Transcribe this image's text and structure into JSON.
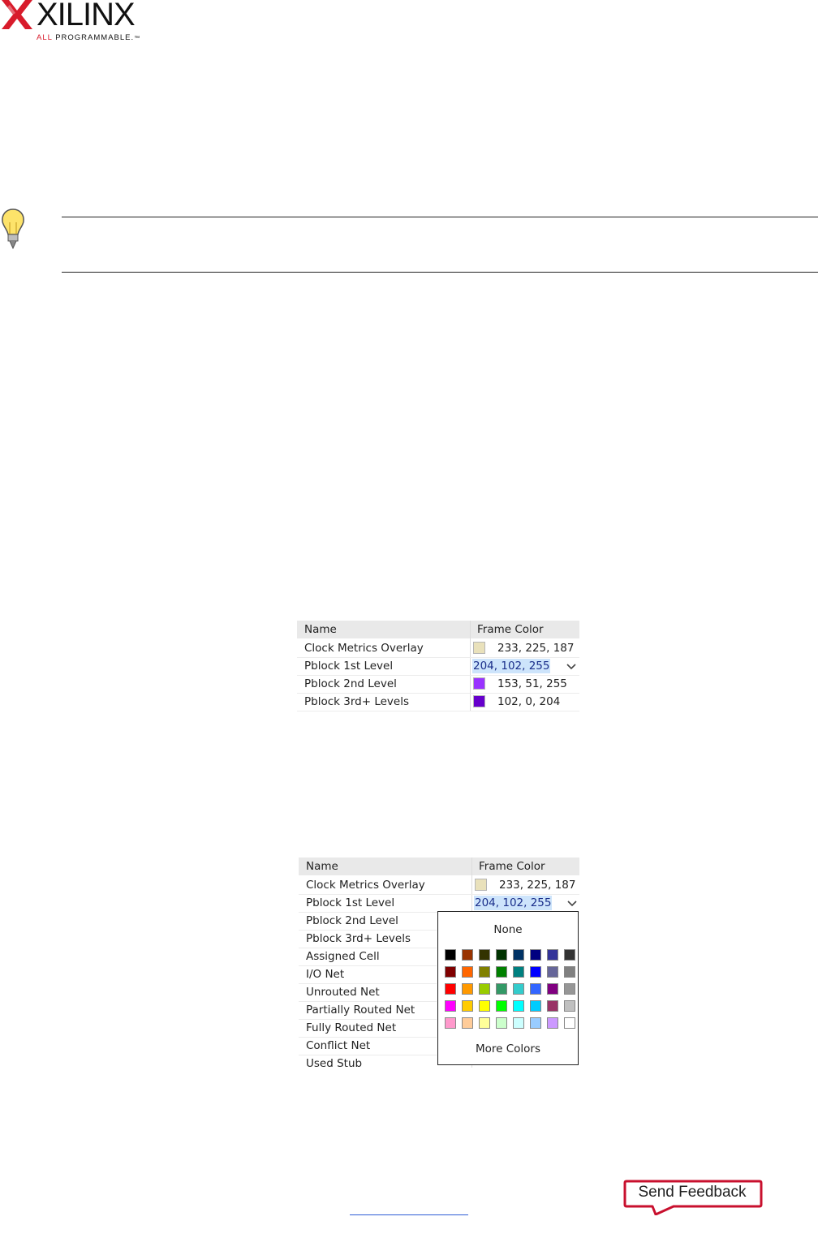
{
  "logo": {
    "wordmark": "XILINX",
    "tagline_prefix": "ALL",
    "tagline_rest": " PROGRAMMABLE.",
    "trademark": "™"
  },
  "colors": {
    "brand_red": "#d81b2b",
    "selection": "#cde4fb",
    "feedback_border": "#c8102e"
  },
  "table1": {
    "headers": [
      "Name",
      "Frame Color"
    ],
    "rows": [
      {
        "name": "Clock Metrics Overlay",
        "swatch": "#e9e1bb",
        "value": "233, 225, 187"
      },
      {
        "name": "Pblock 1st Level",
        "swatch": "#cc66ff",
        "value": "204, 102, 255",
        "editing": true
      },
      {
        "name": "Pblock 2nd Level",
        "swatch": "#9933ff",
        "value": "153, 51, 255"
      },
      {
        "name": "Pblock 3rd+ Levels",
        "swatch": "#6600cc",
        "value": "102, 0, 204"
      }
    ]
  },
  "table2": {
    "headers": [
      "Name",
      "Frame Color"
    ],
    "rows": [
      {
        "name": "Clock Metrics Overlay",
        "swatch": "#e9e1bb",
        "value": "233, 225, 187"
      },
      {
        "name": "Pblock 1st Level",
        "value": "204, 102, 255",
        "editing": true
      },
      {
        "name": "Pblock 2nd Level"
      },
      {
        "name": "Pblock 3rd+ Levels"
      },
      {
        "name": "Assigned Cell"
      },
      {
        "name": "I/O Net"
      },
      {
        "name": "Unrouted Net"
      },
      {
        "name": "Partially Routed Net"
      },
      {
        "name": "Fully Routed Net"
      },
      {
        "name": "Conflict Net"
      },
      {
        "name": "Used Stub"
      }
    ]
  },
  "color_popup": {
    "none_label": "None",
    "more_label": "More Colors",
    "palette": [
      [
        "#000000",
        "#993300",
        "#333300",
        "#003300",
        "#003366",
        "#000080",
        "#333399",
        "#333333"
      ],
      [
        "#800000",
        "#ff6600",
        "#808000",
        "#008000",
        "#008080",
        "#0000ff",
        "#666699",
        "#808080"
      ],
      [
        "#ff0000",
        "#ff9900",
        "#99cc00",
        "#339966",
        "#33cccc",
        "#3366ff",
        "#800080",
        "#969696"
      ],
      [
        "#ff00ff",
        "#ffcc00",
        "#ffff00",
        "#00ff00",
        "#00ffff",
        "#00ccff",
        "#993366",
        "#c0c0c0"
      ],
      [
        "#ff99cc",
        "#ffcc99",
        "#ffff99",
        "#ccffcc",
        "#ccffff",
        "#99ccff",
        "#cc99ff",
        "#ffffff"
      ]
    ]
  },
  "feedback": {
    "label": "Send Feedback"
  }
}
